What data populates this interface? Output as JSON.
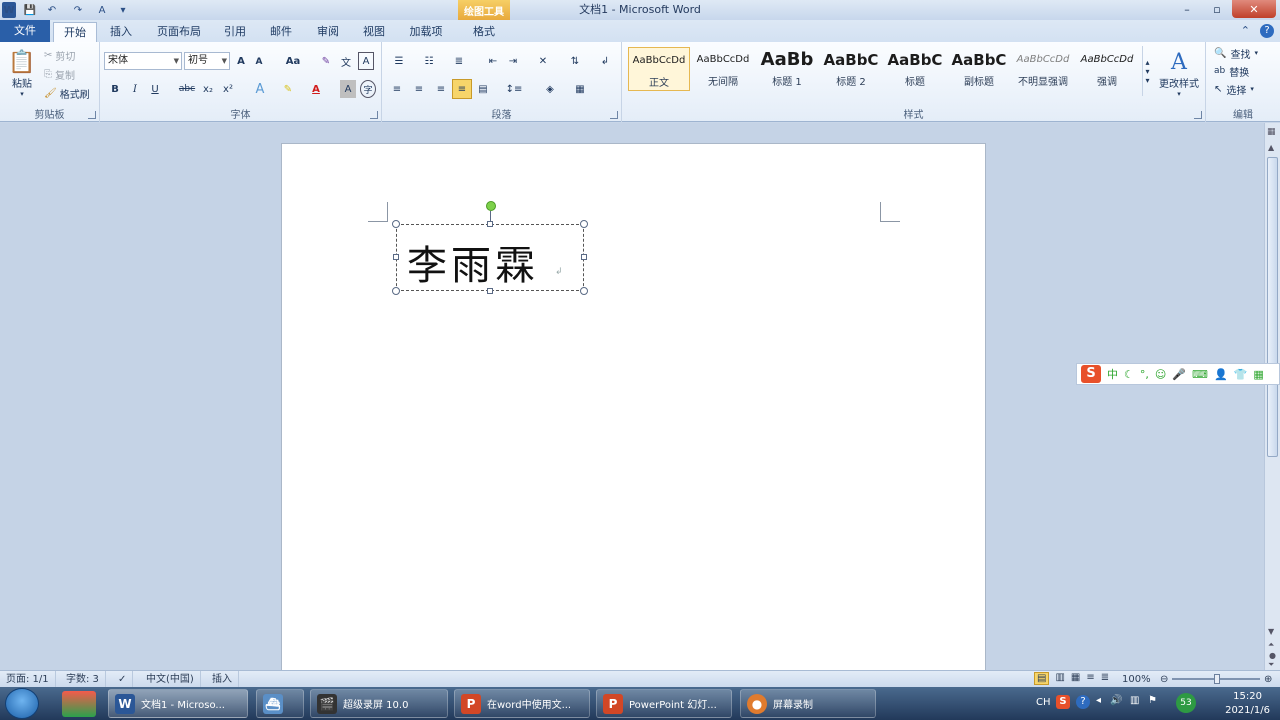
{
  "window": {
    "title": "文档1 - Microsoft Word",
    "tools_tab_header": "绘图工具",
    "minimize": "–",
    "maximize": "▫",
    "close": "✕"
  },
  "tabs": [
    "文件",
    "开始",
    "插入",
    "页面布局",
    "引用",
    "邮件",
    "审阅",
    "视图",
    "加载项",
    "格式"
  ],
  "ribbon": {
    "clipboard": {
      "label": "剪贴板",
      "paste": "粘贴",
      "cut": "剪切",
      "copy": "复制",
      "format_painter": "格式刷"
    },
    "font": {
      "label": "字体",
      "font_name": "宋体",
      "font_size": "初号",
      "bold": "B",
      "italic": "I",
      "underline": "U",
      "strikethrough": "abc",
      "subscript": "x₂",
      "superscript": "x²",
      "grow": "A",
      "shrink": "A",
      "change_case": "Aa",
      "clear_format": "A"
    },
    "paragraph": {
      "label": "段落"
    },
    "styles": {
      "label": "样式",
      "change_styles": "更改样式",
      "items": [
        {
          "sample": "AaBbCcDd",
          "name": "正文"
        },
        {
          "sample": "AaBbCcDd",
          "name": "无间隔"
        },
        {
          "sample": "AaBb",
          "name": "标题 1"
        },
        {
          "sample": "AaBbC",
          "name": "标题 2"
        },
        {
          "sample": "AaBbC",
          "name": "标题"
        },
        {
          "sample": "AaBbC",
          "name": "副标题"
        },
        {
          "sample": "AaBbCcDd",
          "name": "不明显强调"
        },
        {
          "sample": "AaBbCcDd",
          "name": "强调"
        }
      ]
    },
    "editing": {
      "label": "编辑",
      "find": "查找",
      "replace": "替换",
      "select": "选择"
    }
  },
  "document": {
    "textbox_text": "李雨霖"
  },
  "statusbar": {
    "page": "页面: 1/1",
    "words": "字数: 3",
    "language": "中文(中国)",
    "mode": "插入",
    "zoom": "100%"
  },
  "ime": {
    "logo": "S",
    "mode": "中"
  },
  "taskbar": {
    "tasks": [
      {
        "label": "文档1 - Microso...",
        "icon": "W",
        "color": "#2b5797"
      },
      {
        "label": "",
        "icon": "",
        "color": "#5a8fc7"
      },
      {
        "label": "超级录屏 10.0",
        "icon": "🎬",
        "color": "#333"
      },
      {
        "label": "在word中使用文...",
        "icon": "P",
        "color": "#d24726"
      },
      {
        "label": "PowerPoint 幻灯...",
        "icon": "P",
        "color": "#d24726"
      },
      {
        "label": "屏幕录制",
        "icon": "●",
        "color": "#e07b2e"
      }
    ],
    "time": "15:20",
    "date": "2021/1/6",
    "lang_indicator": "CH",
    "badge": "53"
  }
}
